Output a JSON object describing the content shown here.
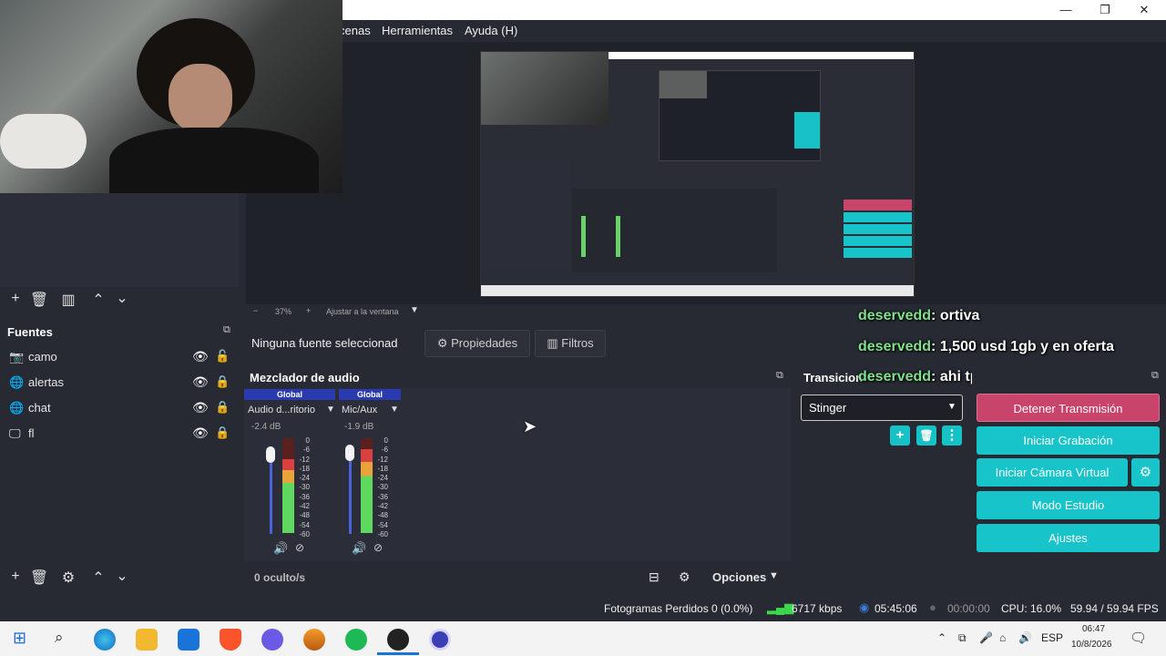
{
  "window": {
    "minimize": "—",
    "restore": "❐",
    "close": "✕"
  },
  "menu": {
    "items": [
      "cenas",
      "Herramientas",
      "Ayuda (H)"
    ]
  },
  "preview": {
    "zoom": "37%",
    "fit_label": "Ajustar a la ventana"
  },
  "sources": {
    "title": "Fuentes",
    "items": [
      {
        "name": "camo",
        "icon": "camera-icon"
      },
      {
        "name": "alertas",
        "icon": "globe-icon"
      },
      {
        "name": "chat",
        "icon": "globe-icon"
      },
      {
        "name": "fl",
        "icon": "monitor-icon"
      }
    ]
  },
  "context": {
    "no_source": "Ninguna fuente seleccionad",
    "properties": "Propiedades",
    "filters": "Filtros"
  },
  "chat": {
    "lines": [
      {
        "user": "deservedd",
        "message": ": ortiva"
      },
      {
        "user": "deservedd",
        "message": ": 1,500 usd 1gb y en oferta"
      },
      {
        "user": "deservedd",
        "message": ": ahi tpase bebotee"
      }
    ]
  },
  "mixer": {
    "title": "Mezclador de audio",
    "channels": [
      {
        "global": "Global",
        "name": "Audio d...ritorio",
        "db": "-2.4 dB",
        "level": 0.78
      },
      {
        "global": "Global",
        "name": "Mic/Aux",
        "db": "-1.9 dB",
        "level": 0.88
      }
    ],
    "scale": [
      "0",
      "-6",
      "-12",
      "-18",
      "-24",
      "-30",
      "-36",
      "-42",
      "-48",
      "-54",
      "-60"
    ],
    "hidden": "0 oculto/s",
    "options": "Opciones"
  },
  "transitions": {
    "title": "Transicion",
    "selected": "Stinger"
  },
  "controls": {
    "stop_stream": "Detener Transmisión",
    "start_recording": "Iniciar Grabación",
    "start_virtual_cam": "Iniciar Cámara Virtual",
    "studio_mode": "Modo Estudio",
    "settings": "Ajustes"
  },
  "status": {
    "dropped_frames": "Fotogramas Perdidos 0 (0.0%)",
    "bitrate": "6717 kbps",
    "live_time": "05:45:06",
    "rec_time": "00:00:00",
    "cpu": "CPU: 16.0%",
    "fps": "59.94 / 59.94 FPS"
  },
  "taskbar": {
    "lang": "ESP",
    "time": "06:47",
    "date": "10/8/2026"
  },
  "colors": {
    "accent": "#17c4c9",
    "stop": "#c8446a",
    "global_header": "#2a3ab0",
    "chat_user": "#7ee28a"
  }
}
